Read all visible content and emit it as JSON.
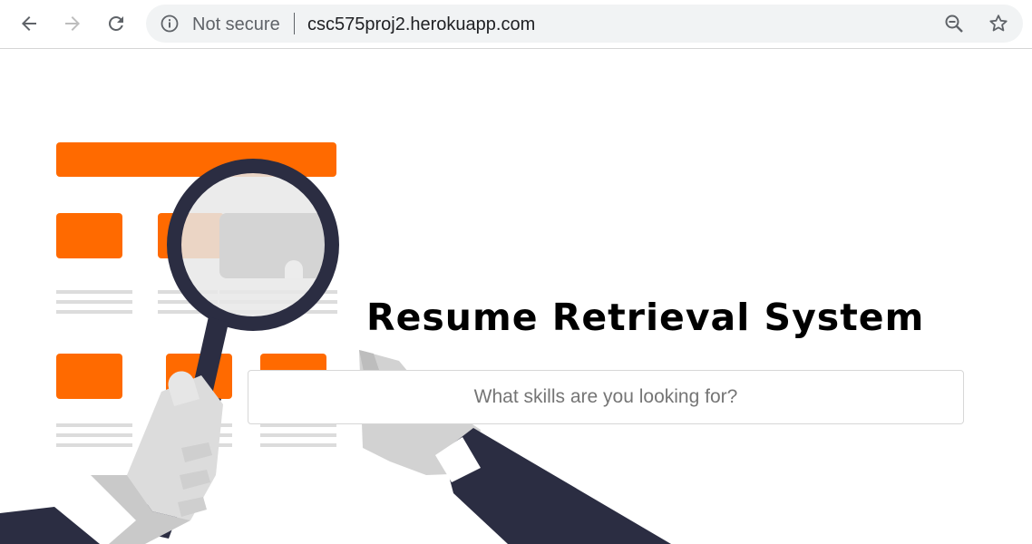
{
  "browser": {
    "security_label": "Not secure",
    "url": "csc575proj2.herokuapp.com",
    "icons": [
      "back-arrow-icon",
      "forward-arrow-icon",
      "reload-icon",
      "info-icon",
      "zoom-out-icon",
      "star-icon"
    ]
  },
  "page": {
    "title": "Resume Retrieval System",
    "search": {
      "placeholder": "What skills are you looking for?",
      "value": ""
    }
  },
  "colors": {
    "accent": "#ff6a00",
    "navy": "#2b2d42",
    "placeholder_gray": "#dcdcdc"
  }
}
